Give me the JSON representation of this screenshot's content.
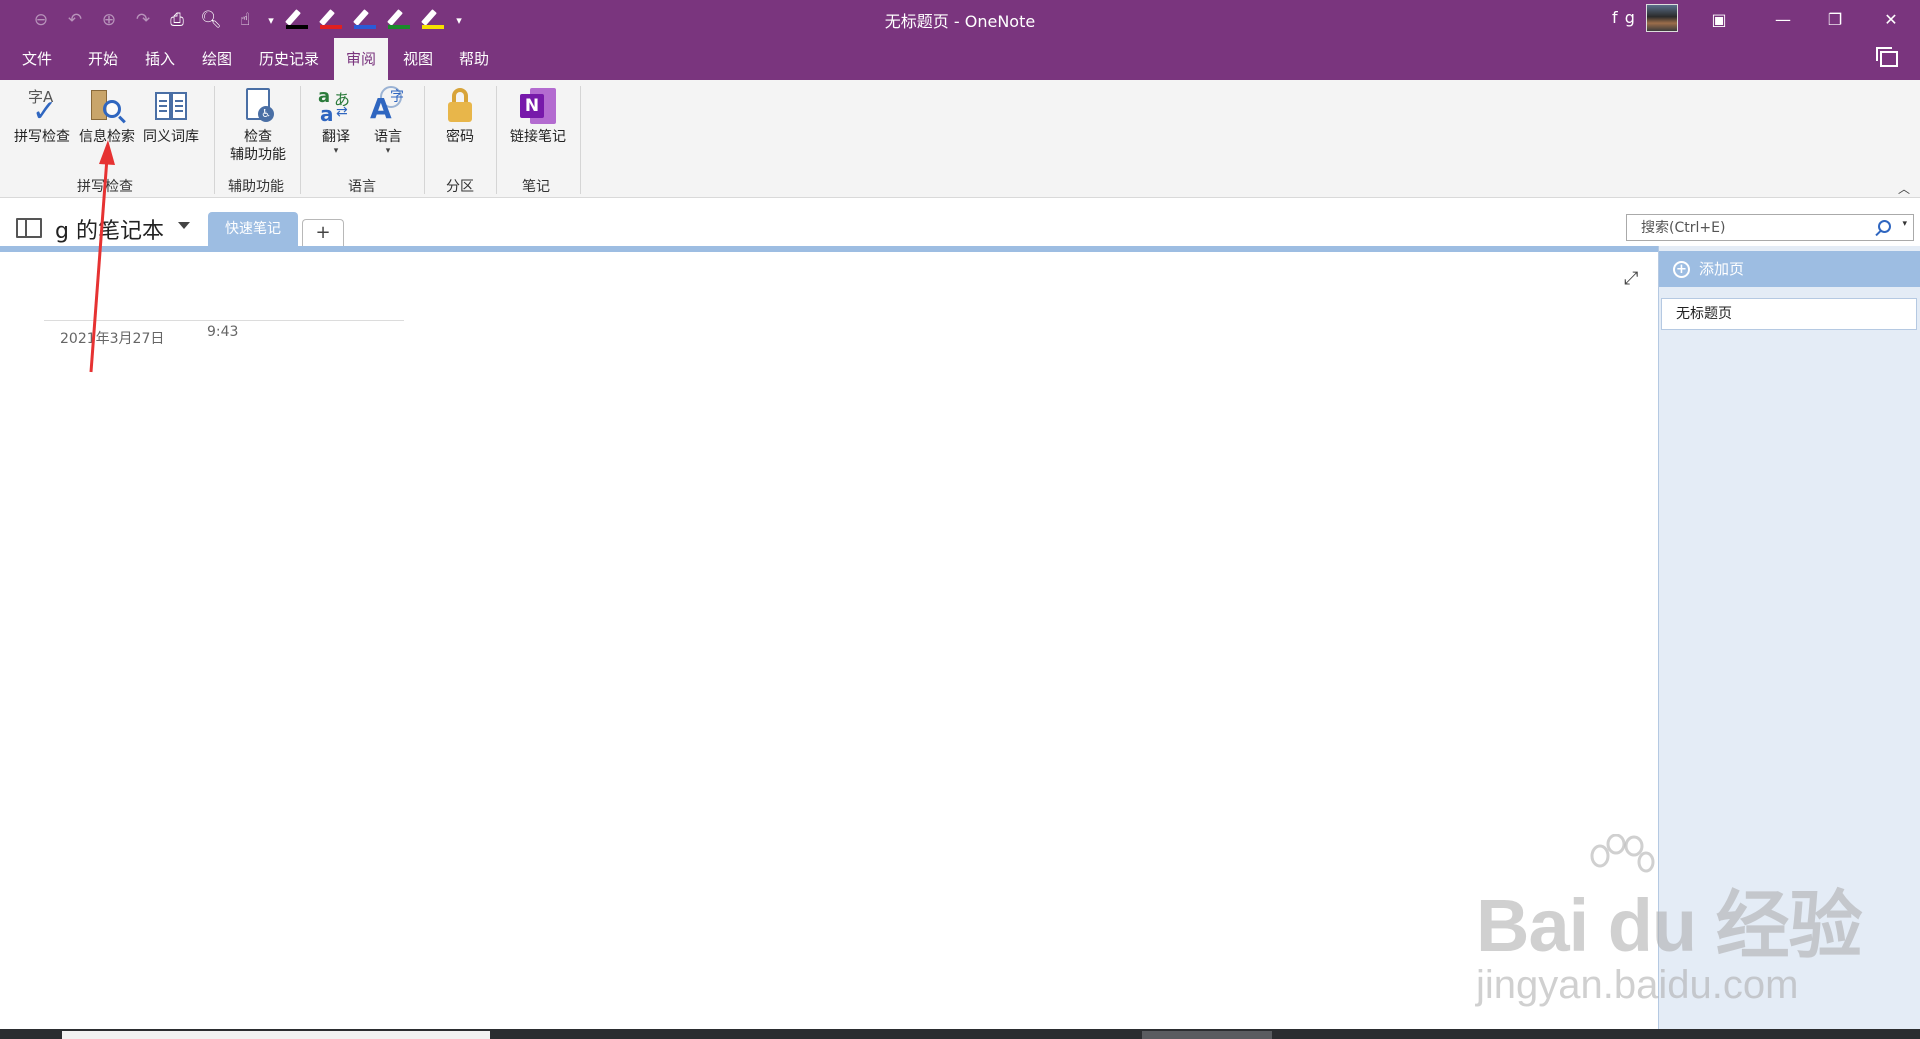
{
  "window": {
    "title": "无标题页 - OneNote",
    "user": "f g"
  },
  "quick_access": {
    "icons": [
      "back-icon",
      "undo-icon",
      "forward-icon",
      "redo-icon",
      "print-icon",
      "print-preview-icon",
      "touch-mode-icon",
      "black-pen-icon",
      "red-pen-icon",
      "blue-pen-icon",
      "green-pen-icon",
      "yellow-highlighter-icon",
      "customize-qat-icon"
    ],
    "pen_colors": [
      "#000000",
      "#e02020",
      "#2a5bd7",
      "#1a8a2a",
      "#f5e000"
    ]
  },
  "menu_tabs": [
    "文件",
    "开始",
    "插入",
    "绘图",
    "历史记录",
    "审阅",
    "视图",
    "帮助"
  ],
  "active_tab": "审阅",
  "ribbon": {
    "groups": {
      "spelling": {
        "label": "拼写检查",
        "buttons": [
          "拼写检查",
          "信息检索",
          "同义词库"
        ]
      },
      "accessibility": {
        "label": "辅助功能",
        "button_line1": "检查",
        "button_line2": "辅助功能"
      },
      "language": {
        "label": "语言",
        "buttons": [
          "翻译",
          "语言"
        ]
      },
      "section": {
        "label": "分区",
        "button": "密码"
      },
      "notes": {
        "label": "笔记",
        "button": "链接笔记"
      }
    }
  },
  "notebook": {
    "name": "g 的笔记本",
    "section_tab": "快速笔记",
    "add_section_label": "+"
  },
  "search": {
    "placeholder": "搜索(Ctrl+E)"
  },
  "page": {
    "date": "2021年3月27日",
    "time": "9:43"
  },
  "page_list": {
    "add_page_label": "添加页",
    "pages": [
      "无标题页"
    ]
  },
  "watermark": {
    "brand": "Bai du 经验",
    "url": "jingyan.baidu.com"
  },
  "colors": {
    "accent": "#7a357e",
    "section_blue": "#9dbde2",
    "annotation": "#e63232"
  }
}
